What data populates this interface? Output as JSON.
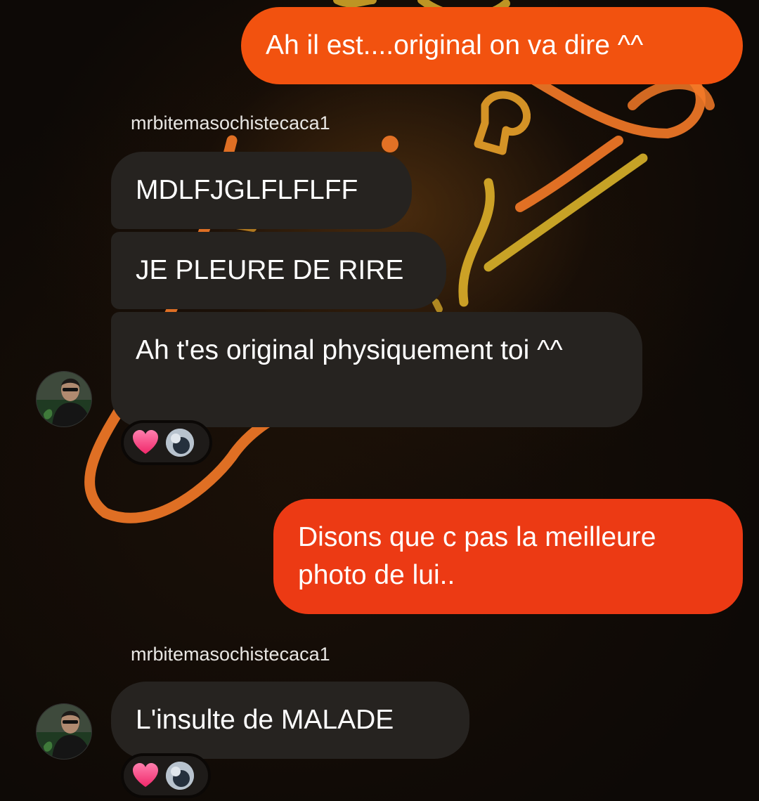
{
  "colors": {
    "outgoing_gradient_top": "#f2520f",
    "outgoing_gradient_bottom": "#ec3a14",
    "incoming_bubble": "#262320",
    "neon_orange": "#f57a28",
    "neon_yellow": "#e8b82c"
  },
  "messages": [
    {
      "text": "Ah il est....original on va dire ^^"
    },
    {
      "sender": "mrbitemasochistecaca1"
    },
    {
      "text": "MDLFJGLFLFLFF"
    },
    {
      "text": "JE PLEURE DE RIRE"
    },
    {
      "text": "Ah t'es original physiquement toi ^^",
      "reaction": "heart"
    },
    {
      "text": "Disons que c pas la meilleure photo de lui.."
    },
    {
      "sender": "mrbitemasochistecaca1"
    },
    {
      "text": "L'insulte de MALADE",
      "reaction": "heart"
    }
  ]
}
